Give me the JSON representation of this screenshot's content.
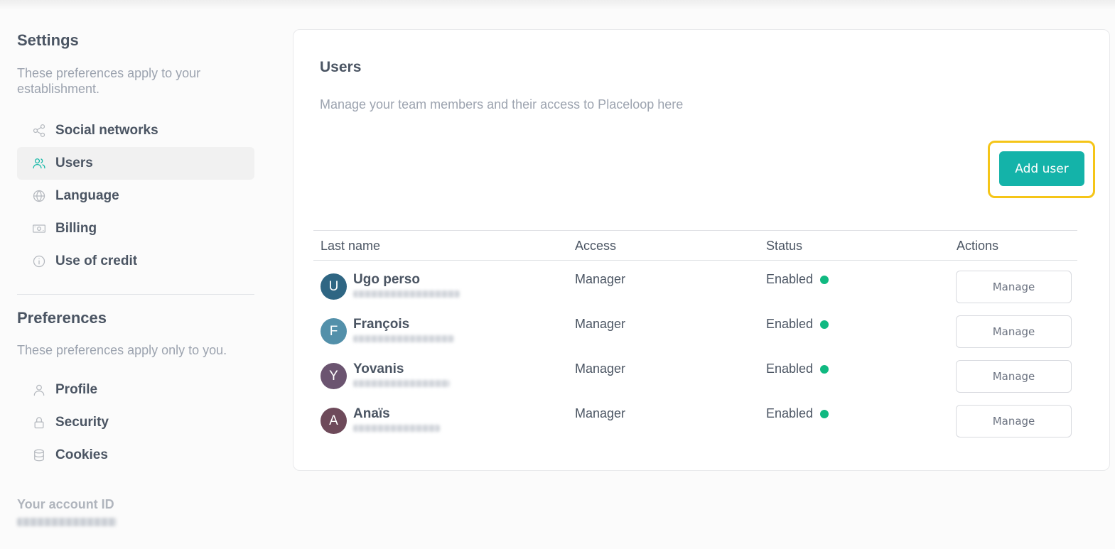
{
  "sidebar": {
    "settings_title": "Settings",
    "settings_desc": "These preferences apply to your establishment.",
    "settings_items": [
      {
        "label": "Social networks",
        "icon": "share-icon"
      },
      {
        "label": "Users",
        "icon": "users-icon",
        "active": true
      },
      {
        "label": "Language",
        "icon": "globe-icon"
      },
      {
        "label": "Billing",
        "icon": "banknote-icon"
      },
      {
        "label": "Use of credit",
        "icon": "info-icon"
      }
    ],
    "preferences_title": "Preferences",
    "preferences_desc": "These preferences apply only to you.",
    "preferences_items": [
      {
        "label": "Profile",
        "icon": "user-icon"
      },
      {
        "label": "Security",
        "icon": "lock-icon"
      },
      {
        "label": "Cookies",
        "icon": "database-icon"
      }
    ],
    "account_id_label": "Your account ID"
  },
  "main": {
    "title": "Users",
    "description": "Manage your team members and their access to Placeloop here",
    "add_user_label": "Add user",
    "columns": [
      "Last name",
      "Access",
      "Status",
      "Actions"
    ],
    "users": [
      {
        "initial": "U",
        "name": "Ugo perso",
        "access": "Manager",
        "status": "Enabled",
        "action": "Manage",
        "avatar_color": "#2f6683"
      },
      {
        "initial": "F",
        "name": "François",
        "access": "Manager",
        "status": "Enabled",
        "action": "Manage",
        "avatar_color": "#5390aa"
      },
      {
        "initial": "Y",
        "name": "Yovanis",
        "access": "Manager",
        "status": "Enabled",
        "action": "Manage",
        "avatar_color": "#6b5470"
      },
      {
        "initial": "A",
        "name": "Anaïs",
        "access": "Manager",
        "status": "Enabled",
        "action": "Manage",
        "avatar_color": "#6e4a5a"
      }
    ]
  },
  "colors": {
    "accent": "#14b3a9",
    "status_enabled": "#10b981",
    "highlight": "#f5c518"
  }
}
